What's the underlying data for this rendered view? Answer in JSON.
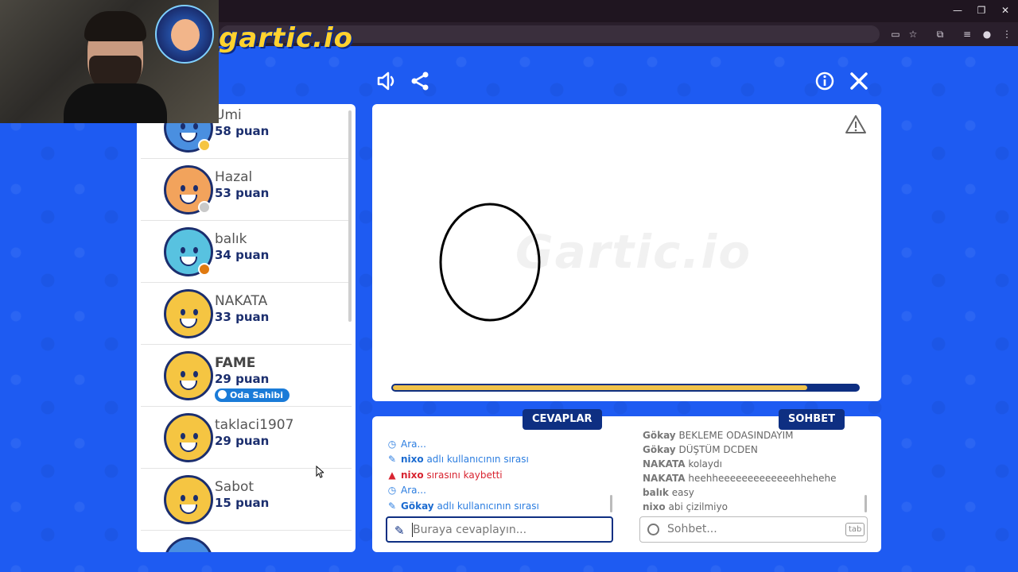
{
  "browser": {
    "window_controls": [
      "—",
      "❐",
      "✕"
    ]
  },
  "game": {
    "logo_text": "gartic.io",
    "watermark_text": "Gartic.io"
  },
  "players": [
    {
      "name": "Umi",
      "score": "58 puan",
      "status_color": "#f5c542"
    },
    {
      "name": "Hazal",
      "score": "53 puan",
      "status_color": "#c9c9c9"
    },
    {
      "name": "balık",
      "score": "34 puan",
      "status_color": "#e07a10"
    },
    {
      "name": "NAKATA",
      "score": "33 puan",
      "status_color": ""
    },
    {
      "name": "FAME",
      "score": "29 puan",
      "badge": "Oda Sahibi"
    },
    {
      "name": "taklaci1907",
      "score": "29 puan",
      "status_color": ""
    },
    {
      "name": "Sabot",
      "score": "15 puan",
      "status_color": ""
    }
  ],
  "drawing": {
    "progress": 0.89
  },
  "answers": {
    "tab_label": "CEVAPLAR",
    "log": [
      {
        "type": "clock",
        "text": "Ara..."
      },
      {
        "type": "pencil",
        "user": "nixo",
        "text": " adlı kullanıcının sırası"
      },
      {
        "type": "warning",
        "user": "nixo",
        "text": " sırasını kaybetti"
      },
      {
        "type": "clock",
        "text": "Ara..."
      },
      {
        "type": "pencil",
        "user": "Gökay",
        "text": " adlı kullanıcının sırası"
      }
    ],
    "input_placeholder": "Buraya cevaplayın..."
  },
  "chat": {
    "tab_label": "SOHBET",
    "messages": [
      {
        "user": "Gökay",
        "text": "BEKLEME ODASINDAYIM"
      },
      {
        "user": "Gökay",
        "text": "DÜŞTÜM DCDEN"
      },
      {
        "user": "NAKATA",
        "text": "kolaydı"
      },
      {
        "user": "NAKATA",
        "text": "heehheeeeeeeeeeeeehhehehe"
      },
      {
        "user": "balık",
        "text": "easy"
      },
      {
        "user": "nixo",
        "text": "abi çizilmiyo"
      }
    ],
    "input_placeholder": "Sohbet...",
    "tab_hint": "tab"
  },
  "icons": {
    "sound": "speaker-icon",
    "share": "share-icon",
    "info": "info-icon",
    "close": "close-icon",
    "report": "warning-icon"
  },
  "colors": {
    "background": "#1e5bf2",
    "navy": "#0e2f82",
    "accent_yellow": "#f0c24a",
    "link_blue": "#2b7de0",
    "alert_red": "#d82430"
  }
}
